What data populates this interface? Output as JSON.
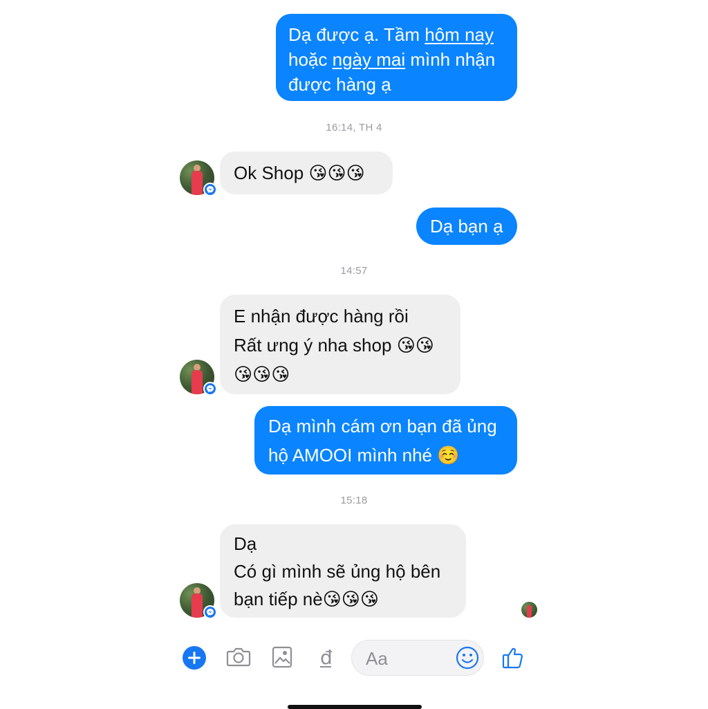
{
  "messages": [
    {
      "id": "m1",
      "lines": [
        "Dạ được ạ. Tầm hôm nay",
        "hoặc ngày mai mình nhận",
        "được hàng ạ"
      ]
    },
    {
      "id": "ts1",
      "text": "16:14, TH 4"
    },
    {
      "id": "m2",
      "text": "Ok Shop",
      "emoji": "😘😘😘"
    },
    {
      "id": "m3",
      "text": "Dạ bạn ạ"
    },
    {
      "id": "ts2",
      "text": "14:57"
    },
    {
      "id": "m4",
      "lines": [
        "E nhận được hàng rồi",
        "Rất ưng ý nha shop"
      ],
      "emoji_line1": "😘😘",
      "emoji_line2": "😘😘😘"
    },
    {
      "id": "m5",
      "lines": [
        "Dạ mình cám ơn bạn đã ủng",
        "hộ AMOOI mình nhé"
      ],
      "emoji": "☺️"
    },
    {
      "id": "ts3",
      "text": "15:18"
    },
    {
      "id": "m6",
      "lines": [
        "Dạ",
        "Có gì  mình sẽ ủng hộ bên",
        "bạn tiếp nè"
      ],
      "emoji": "😘😘😘"
    }
  ],
  "m1": {
    "line1_a": "Dạ được ạ. Tầm ",
    "line1_u": "hôm nay",
    "line2_a": "hoặc ",
    "line2_u": "ngày mai",
    "line2_b": " mình nhận",
    "line3": "được hàng ạ"
  },
  "composer": {
    "placeholder": "Aa",
    "icons": [
      "plus-icon",
      "camera-icon",
      "photo-icon",
      "dong-currency-icon",
      "emoji-icon",
      "thumbs-up-icon"
    ]
  },
  "colors": {
    "outgoing": "#0a84ff",
    "incoming": "#efeff0",
    "timestamp": "#9b9ba0",
    "accent": "#1877f2"
  }
}
